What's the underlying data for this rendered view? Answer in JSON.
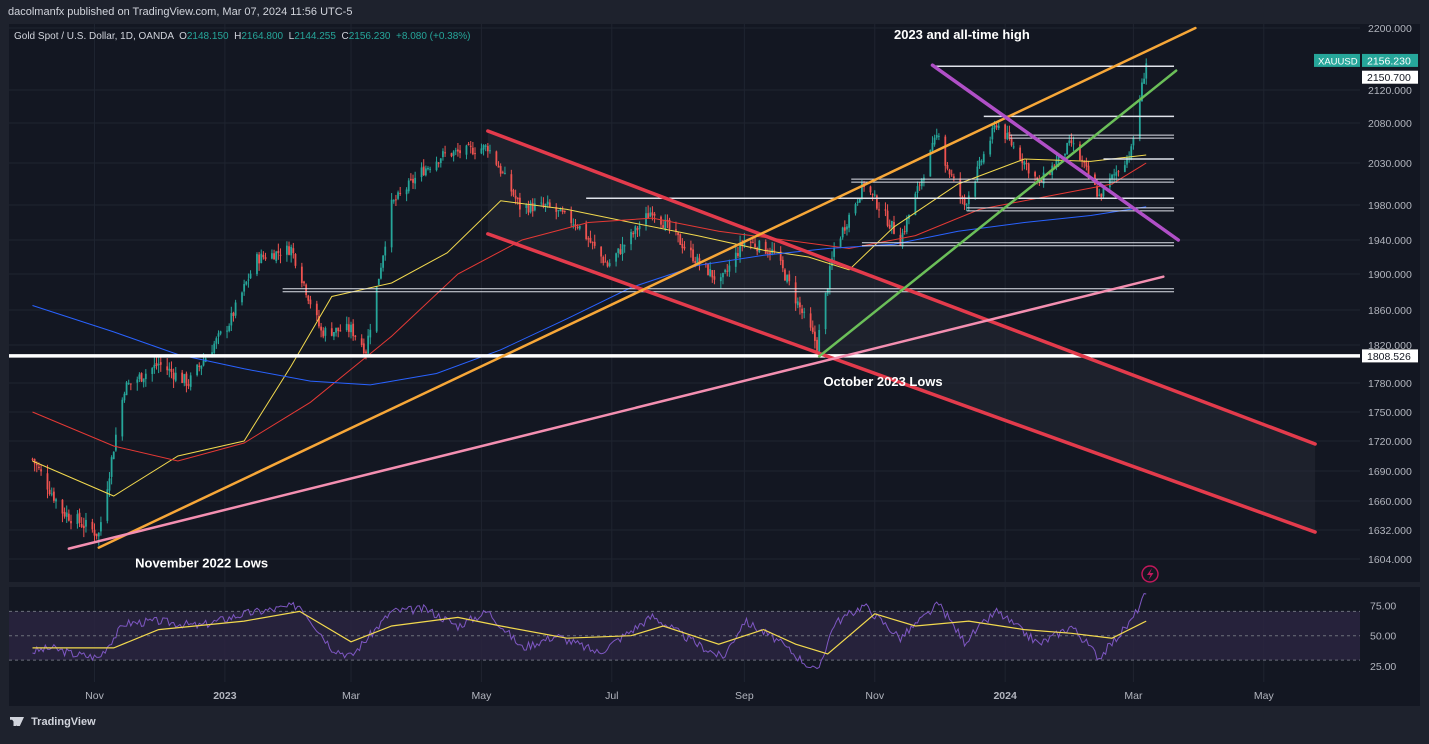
{
  "header": {
    "publisher_line": "dacolmanfx published on TradingView.com, Mar 07, 2024 11:56 UTC-5",
    "instrument": "Gold Spot / U.S. Dollar, 1D, OANDA",
    "ohlc": {
      "o_label": "O",
      "o": "2148.150",
      "h_label": "H",
      "h": "2164.800",
      "l_label": "L",
      "l": "2144.255",
      "c_label": "C",
      "c": "2156.230",
      "change": "+8.080 (+0.38%)"
    }
  },
  "footer": {
    "brand": "TradingView"
  },
  "colors": {
    "background": "#1e222d",
    "panel": "#131722",
    "up": "#26a69a",
    "down": "#ef5350",
    "sma50": "#f2d94e",
    "sma100": "#e53935",
    "sma200": "#2962ff",
    "channel": "#e33b4c",
    "rising_wedge": "#f7a738",
    "support_green": "#6bbf59",
    "descending_purple": "#b04fc7",
    "pink_trend": "#f48fb1",
    "rsi": "#7e57c2",
    "rsi_ma": "#f2d94e"
  },
  "chart_data": {
    "type": "line",
    "title": "Gold Spot / U.S. Dollar, 1D, OANDA",
    "symbol": "XAUUSD",
    "x_tick_labels": [
      "Nov",
      "2023",
      "Mar",
      "May",
      "Jul",
      "Sep",
      "Nov",
      "2024",
      "Mar",
      "May"
    ],
    "y_ticks": [
      1604.0,
      1632.0,
      1660.0,
      1690.0,
      1720.0,
      1750.0,
      1780.0,
      1820.0,
      1860.0,
      1900.0,
      1940.0,
      1980.0,
      2030.0,
      2080.0,
      2120.0,
      2200.0
    ],
    "y_tick_labels": [
      "1604.000",
      "1632.000",
      "1660.000",
      "1690.000",
      "1720.000",
      "1750.000",
      "1780.000",
      "1820.000",
      "1860.000",
      "1900.000",
      "1940.000",
      "1980.000",
      "2030.000",
      "2080.000",
      "2120.000",
      "2200.000"
    ],
    "ylim": [
      1585,
      2205
    ],
    "price_labels": [
      {
        "text": "XAUUSD",
        "value": 2156.23,
        "style": "symbol"
      },
      {
        "text": "2156.230",
        "value": 2156.23,
        "style": "last"
      },
      {
        "text": "2150.700",
        "value": 2150.7,
        "style": "level"
      },
      {
        "text": "1808.526",
        "value": 1808.526,
        "style": "level"
      }
    ],
    "close_series": [
      {
        "date": "2022-10-03",
        "close": 1702
      },
      {
        "date": "2022-10-17",
        "close": 1650
      },
      {
        "date": "2022-11-03",
        "close": 1628
      },
      {
        "date": "2022-11-15",
        "close": 1775
      },
      {
        "date": "2022-12-01",
        "close": 1800
      },
      {
        "date": "2022-12-15",
        "close": 1780
      },
      {
        "date": "2023-01-03",
        "close": 1845
      },
      {
        "date": "2023-01-16",
        "close": 1918
      },
      {
        "date": "2023-02-01",
        "close": 1930
      },
      {
        "date": "2023-02-15",
        "close": 1835
      },
      {
        "date": "2023-03-01",
        "close": 1838
      },
      {
        "date": "2023-03-08",
        "close": 1815
      },
      {
        "date": "2023-03-20",
        "close": 1980
      },
      {
        "date": "2023-04-03",
        "close": 2020
      },
      {
        "date": "2023-04-13",
        "close": 2040
      },
      {
        "date": "2023-05-04",
        "close": 2050
      },
      {
        "date": "2023-05-19",
        "close": 1978
      },
      {
        "date": "2023-06-01",
        "close": 1978
      },
      {
        "date": "2023-06-15",
        "close": 1958
      },
      {
        "date": "2023-06-29",
        "close": 1910
      },
      {
        "date": "2023-07-20",
        "close": 1975
      },
      {
        "date": "2023-08-10",
        "close": 1915
      },
      {
        "date": "2023-08-21",
        "close": 1890
      },
      {
        "date": "2023-09-01",
        "close": 1940
      },
      {
        "date": "2023-09-15",
        "close": 1925
      },
      {
        "date": "2023-10-05",
        "close": 1820
      },
      {
        "date": "2023-10-13",
        "close": 1930
      },
      {
        "date": "2023-10-27",
        "close": 2005
      },
      {
        "date": "2023-11-13",
        "close": 1940
      },
      {
        "date": "2023-12-01",
        "close": 2070
      },
      {
        "date": "2023-12-04",
        "close": 2030
      },
      {
        "date": "2023-12-13",
        "close": 1980
      },
      {
        "date": "2023-12-28",
        "close": 2080
      },
      {
        "date": "2024-01-17",
        "close": 2005
      },
      {
        "date": "2024-02-01",
        "close": 2055
      },
      {
        "date": "2024-02-14",
        "close": 1990
      },
      {
        "date": "2024-02-29",
        "close": 2045
      },
      {
        "date": "2024-03-07",
        "close": 2156.23
      }
    ],
    "moving_averages": [
      {
        "name": "SMA 50",
        "color": "#f2d94e",
        "points": [
          {
            "date": "2022-10-03",
            "value": 1700
          },
          {
            "date": "2022-11-10",
            "value": 1665
          },
          {
            "date": "2022-12-10",
            "value": 1705
          },
          {
            "date": "2023-01-10",
            "value": 1720
          },
          {
            "date": "2023-02-01",
            "value": 1798
          },
          {
            "date": "2023-02-20",
            "value": 1875
          },
          {
            "date": "2023-03-20",
            "value": 1890
          },
          {
            "date": "2023-04-15",
            "value": 1925
          },
          {
            "date": "2023-05-10",
            "value": 1985
          },
          {
            "date": "2023-06-10",
            "value": 1975
          },
          {
            "date": "2023-07-10",
            "value": 1960
          },
          {
            "date": "2023-08-10",
            "value": 1945
          },
          {
            "date": "2023-09-10",
            "value": 1928
          },
          {
            "date": "2023-10-01",
            "value": 1920
          },
          {
            "date": "2023-10-20",
            "value": 1905
          },
          {
            "date": "2023-11-10",
            "value": 1955
          },
          {
            "date": "2023-12-10",
            "value": 2005
          },
          {
            "date": "2024-01-10",
            "value": 2035
          },
          {
            "date": "2024-02-10",
            "value": 2032
          },
          {
            "date": "2024-03-07",
            "value": 2040
          }
        ]
      },
      {
        "name": "SMA 100",
        "color": "#e53935",
        "points": [
          {
            "date": "2022-10-03",
            "value": 1750
          },
          {
            "date": "2022-11-10",
            "value": 1715
          },
          {
            "date": "2022-12-10",
            "value": 1700
          },
          {
            "date": "2023-01-10",
            "value": 1718
          },
          {
            "date": "2023-02-10",
            "value": 1760
          },
          {
            "date": "2023-03-20",
            "value": 1830
          },
          {
            "date": "2023-04-20",
            "value": 1900
          },
          {
            "date": "2023-05-20",
            "value": 1940
          },
          {
            "date": "2023-06-20",
            "value": 1960
          },
          {
            "date": "2023-07-20",
            "value": 1965
          },
          {
            "date": "2023-08-20",
            "value": 1950
          },
          {
            "date": "2023-09-20",
            "value": 1940
          },
          {
            "date": "2023-10-20",
            "value": 1930
          },
          {
            "date": "2023-11-20",
            "value": 1945
          },
          {
            "date": "2023-12-20",
            "value": 1975
          },
          {
            "date": "2024-01-20",
            "value": 1990
          },
          {
            "date": "2024-02-20",
            "value": 2005
          },
          {
            "date": "2024-03-07",
            "value": 2030
          }
        ]
      },
      {
        "name": "SMA 200",
        "color": "#2962ff",
        "points": [
          {
            "date": "2022-10-03",
            "value": 1865
          },
          {
            "date": "2022-11-10",
            "value": 1835
          },
          {
            "date": "2022-12-10",
            "value": 1810
          },
          {
            "date": "2023-01-10",
            "value": 1795
          },
          {
            "date": "2023-02-10",
            "value": 1782
          },
          {
            "date": "2023-03-10",
            "value": 1778
          },
          {
            "date": "2023-04-10",
            "value": 1790
          },
          {
            "date": "2023-05-10",
            "value": 1815
          },
          {
            "date": "2023-06-10",
            "value": 1850
          },
          {
            "date": "2023-07-10",
            "value": 1885
          },
          {
            "date": "2023-08-10",
            "value": 1910
          },
          {
            "date": "2023-09-10",
            "value": 1922
          },
          {
            "date": "2023-10-10",
            "value": 1930
          },
          {
            "date": "2023-11-10",
            "value": 1935
          },
          {
            "date": "2023-12-10",
            "value": 1950
          },
          {
            "date": "2024-01-10",
            "value": 1960
          },
          {
            "date": "2024-02-10",
            "value": 1968
          },
          {
            "date": "2024-03-07",
            "value": 1978
          }
        ]
      }
    ],
    "trendlines": [
      {
        "name": "descending-channel-upper",
        "color": "#e33b4c",
        "from": {
          "date": "2023-05-04",
          "value": 2070
        },
        "to": {
          "date": "2024-05-25",
          "value": 1717
        }
      },
      {
        "name": "descending-channel-lower",
        "color": "#e33b4c",
        "from": {
          "date": "2023-05-04",
          "value": 1947
        },
        "to": {
          "date": "2024-05-25",
          "value": 1630
        }
      },
      {
        "name": "rising-trendline-orange",
        "color": "#f7a738",
        "from": {
          "date": "2022-11-03",
          "value": 1615
        },
        "to": {
          "date": "2024-03-30",
          "value": 2200
        }
      },
      {
        "name": "pink-trendline",
        "color": "#f48fb1",
        "from": {
          "date": "2022-10-20",
          "value": 1614
        },
        "to": {
          "date": "2024-03-15",
          "value": 1897
        }
      },
      {
        "name": "green-trendline",
        "color": "#6bbf59",
        "from": {
          "date": "2023-10-06",
          "value": 1808
        },
        "to": {
          "date": "2024-03-21",
          "value": 2145
        }
      },
      {
        "name": "purple-trendline",
        "color": "#b04fc7",
        "from": {
          "date": "2023-11-28",
          "value": 2152
        },
        "to": {
          "date": "2024-03-22",
          "value": 1940
        }
      }
    ],
    "horizontal_levels": [
      {
        "value": 1808.526,
        "from": "2022-09-22",
        "to": "2024-03-20",
        "style": "thick"
      },
      {
        "value": 2150.7,
        "from": "2023-11-28",
        "to": "2024-03-20"
      },
      {
        "value": 2088,
        "from": "2023-12-22",
        "to": "2024-03-20"
      },
      {
        "value": 2063,
        "from": "2024-01-03",
        "to": "2024-03-20",
        "style": "double"
      },
      {
        "value": 2035,
        "from": "2024-02-16",
        "to": "2024-03-20"
      },
      {
        "value": 2009,
        "from": "2023-10-21",
        "to": "2024-03-20",
        "style": "double"
      },
      {
        "value": 1988,
        "from": "2023-06-19",
        "to": "2024-03-20"
      },
      {
        "value": 1975,
        "from": "2023-12-14",
        "to": "2024-03-20",
        "style": "double"
      },
      {
        "value": 1935,
        "from": "2023-10-26",
        "to": "2024-03-20",
        "style": "double"
      },
      {
        "value": 1882,
        "from": "2023-01-28",
        "to": "2024-03-20",
        "style": "double"
      }
    ],
    "annotations": [
      {
        "text": "2023 and all-time high",
        "date": "2023-11-10",
        "value": 2186
      },
      {
        "text": "October 2023 Lows",
        "date": "2023-10-08",
        "value": 1777
      },
      {
        "text": "November 2022 Lows",
        "date": "2022-11-20",
        "value": 1596
      }
    ]
  },
  "rsi_panel": {
    "y_ticks": [
      25.0,
      50.0,
      75.0
    ],
    "y_tick_labels": [
      "25.00",
      "50.00",
      "75.00"
    ],
    "ylim": [
      12,
      90
    ],
    "bands": [
      30,
      70
    ],
    "rsi_series": [
      {
        "date": "2022-10-03",
        "value": 37
      },
      {
        "date": "2022-10-12",
        "value": 40
      },
      {
        "date": "2022-10-22",
        "value": 35
      },
      {
        "date": "2022-11-03",
        "value": 32
      },
      {
        "date": "2022-11-15",
        "value": 60
      },
      {
        "date": "2022-12-01",
        "value": 62
      },
      {
        "date": "2022-12-20",
        "value": 58
      },
      {
        "date": "2023-01-10",
        "value": 68
      },
      {
        "date": "2023-01-25",
        "value": 72
      },
      {
        "date": "2023-02-05",
        "value": 75
      },
      {
        "date": "2023-02-20",
        "value": 40
      },
      {
        "date": "2023-03-01",
        "value": 33
      },
      {
        "date": "2023-03-20",
        "value": 70
      },
      {
        "date": "2023-04-05",
        "value": 72
      },
      {
        "date": "2023-04-20",
        "value": 58
      },
      {
        "date": "2023-05-04",
        "value": 70
      },
      {
        "date": "2023-05-20",
        "value": 40
      },
      {
        "date": "2023-06-05",
        "value": 50
      },
      {
        "date": "2023-06-25",
        "value": 36
      },
      {
        "date": "2023-07-20",
        "value": 66
      },
      {
        "date": "2023-08-10",
        "value": 43
      },
      {
        "date": "2023-08-22",
        "value": 32
      },
      {
        "date": "2023-09-01",
        "value": 62
      },
      {
        "date": "2023-09-15",
        "value": 48
      },
      {
        "date": "2023-10-05",
        "value": 20
      },
      {
        "date": "2023-10-13",
        "value": 60
      },
      {
        "date": "2023-10-27",
        "value": 75
      },
      {
        "date": "2023-11-13",
        "value": 48
      },
      {
        "date": "2023-12-01",
        "value": 76
      },
      {
        "date": "2023-12-13",
        "value": 45
      },
      {
        "date": "2023-12-28",
        "value": 70
      },
      {
        "date": "2024-01-17",
        "value": 43
      },
      {
        "date": "2024-02-01",
        "value": 58
      },
      {
        "date": "2024-02-14",
        "value": 32
      },
      {
        "date": "2024-02-29",
        "value": 62
      },
      {
        "date": "2024-03-07",
        "value": 85
      }
    ],
    "rsi_ma_series": [
      {
        "date": "2022-10-03",
        "value": 40
      },
      {
        "date": "2022-11-10",
        "value": 40
      },
      {
        "date": "2022-12-01",
        "value": 55
      },
      {
        "date": "2023-01-10",
        "value": 62
      },
      {
        "date": "2023-02-05",
        "value": 70
      },
      {
        "date": "2023-03-01",
        "value": 45
      },
      {
        "date": "2023-03-20",
        "value": 58
      },
      {
        "date": "2023-04-20",
        "value": 65
      },
      {
        "date": "2023-05-10",
        "value": 58
      },
      {
        "date": "2023-06-10",
        "value": 48
      },
      {
        "date": "2023-07-10",
        "value": 50
      },
      {
        "date": "2023-07-25",
        "value": 58
      },
      {
        "date": "2023-08-20",
        "value": 43
      },
      {
        "date": "2023-09-10",
        "value": 55
      },
      {
        "date": "2023-09-25",
        "value": 43
      },
      {
        "date": "2023-10-10",
        "value": 35
      },
      {
        "date": "2023-11-01",
        "value": 68
      },
      {
        "date": "2023-11-20",
        "value": 58
      },
      {
        "date": "2023-12-15",
        "value": 62
      },
      {
        "date": "2024-01-10",
        "value": 55
      },
      {
        "date": "2024-02-01",
        "value": 52
      },
      {
        "date": "2024-02-20",
        "value": 48
      },
      {
        "date": "2024-03-07",
        "value": 62
      }
    ]
  }
}
